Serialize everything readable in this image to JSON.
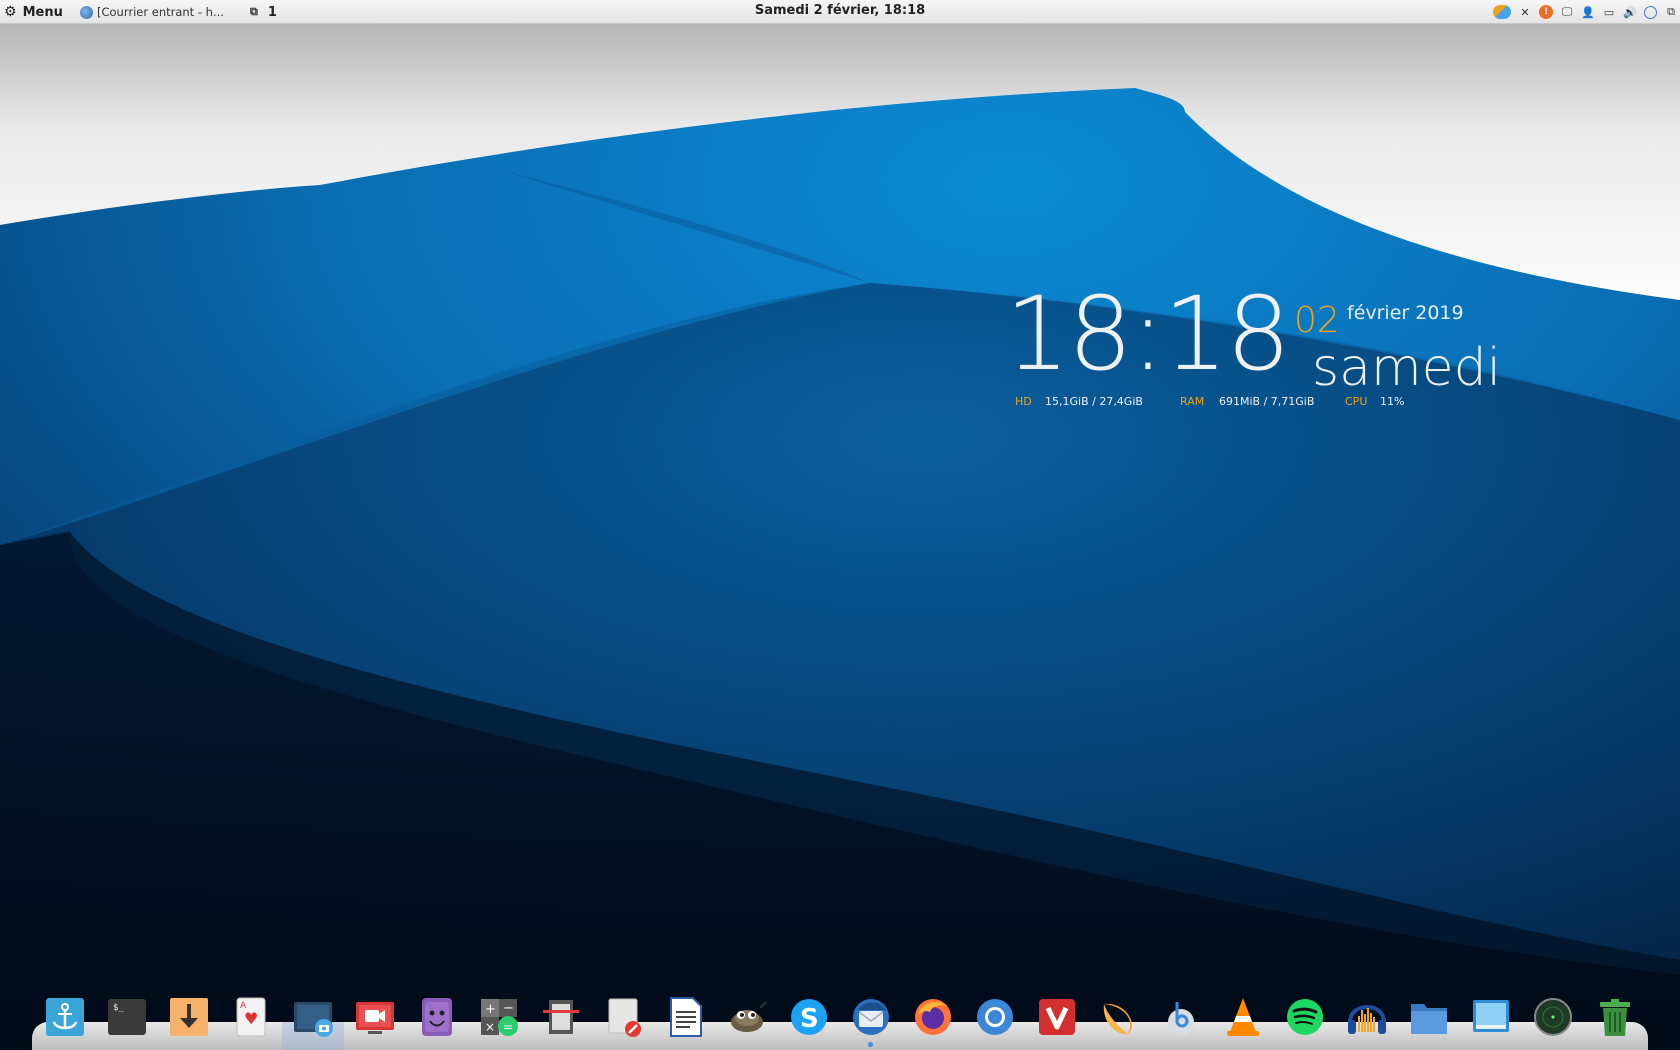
{
  "top_panel": {
    "menu_label": "Menu",
    "task_title": "[Courrier entrant - h...",
    "workspace_number": "1",
    "datetime": "Samedi  2 février, 18:18"
  },
  "tray_icons": [
    "weather-icon",
    "close-icon",
    "update-alert-icon",
    "display-icon",
    "user-icon",
    "screen-icon",
    "volume-icon",
    "clock-icon",
    "network-icon"
  ],
  "desklet": {
    "time": "18:18",
    "day": "02",
    "month_year": "février 2019",
    "weekday": "samedi",
    "hd_label": "HD",
    "hd_value": "15,1GiB / 27,4GiB",
    "ram_label": "RAM",
    "ram_value": "691MiB / 7,71GiB",
    "cpu_label": "CPU",
    "cpu_value": "11%"
  },
  "dock": {
    "items": [
      "anchor",
      "terminal",
      "download",
      "solitaire",
      "screenshot",
      "screen-recorder",
      "sticky-face",
      "calculator",
      "scanner",
      "text-editor",
      "writer",
      "gimp",
      "skype",
      "thunderbird",
      "firefox",
      "chrome",
      "vivaldi",
      "clementine",
      "bluetooth-audio",
      "vlc",
      "spotify",
      "audacity",
      "files",
      "desktop",
      "radar",
      "trash"
    ]
  },
  "colors": {
    "accent_orange": "#f0a21b",
    "wallpaper_blue": "#0a6fb8",
    "panel_bg": "#eeeeee"
  }
}
